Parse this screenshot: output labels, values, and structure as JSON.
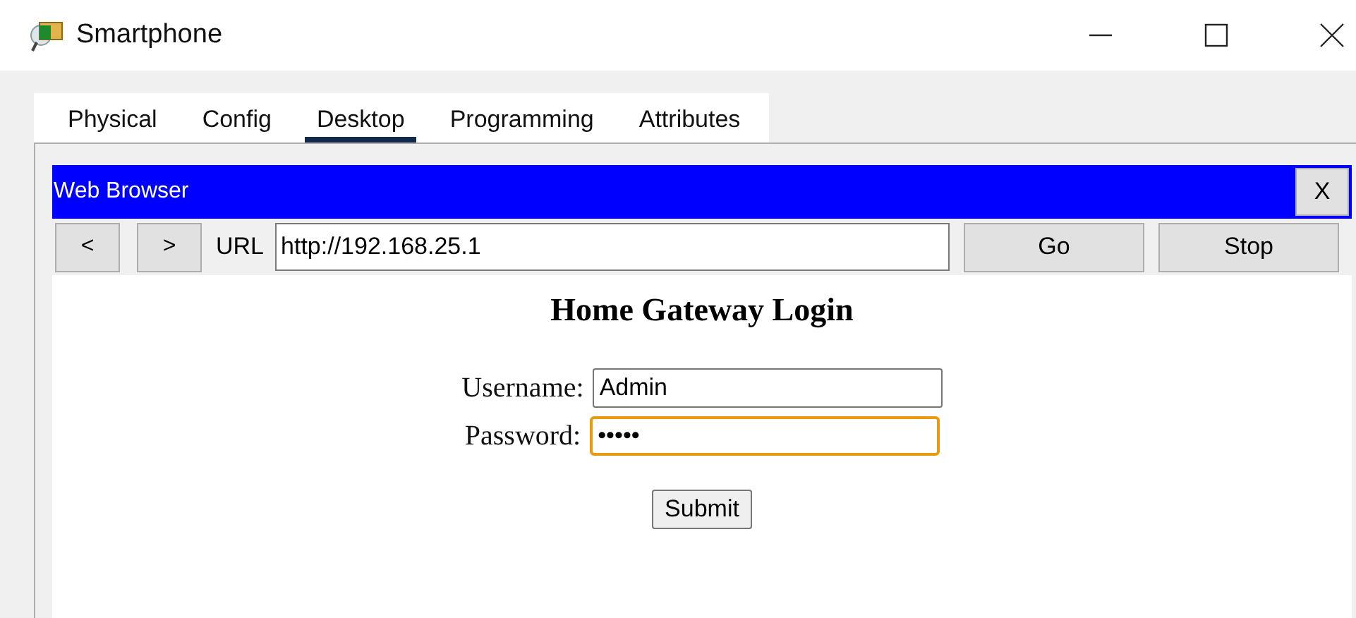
{
  "window": {
    "title": "Smartphone"
  },
  "tabs": [
    {
      "label": "Physical",
      "selected": false
    },
    {
      "label": "Config",
      "selected": false
    },
    {
      "label": "Desktop",
      "selected": true
    },
    {
      "label": "Programming",
      "selected": false
    },
    {
      "label": "Attributes",
      "selected": false
    }
  ],
  "browser": {
    "title": "Web Browser",
    "close_label": "X",
    "back_label": "<",
    "forward_label": ">",
    "url_label": "URL",
    "url": "http://192.168.25.1",
    "go_label": "Go",
    "stop_label": "Stop"
  },
  "page": {
    "heading": "Home Gateway Login",
    "username": {
      "label": "Username:",
      "value": "Admin",
      "focused": false
    },
    "password": {
      "label": "Password:",
      "value": "•••••",
      "focused": true
    },
    "submit_label": "Submit"
  }
}
